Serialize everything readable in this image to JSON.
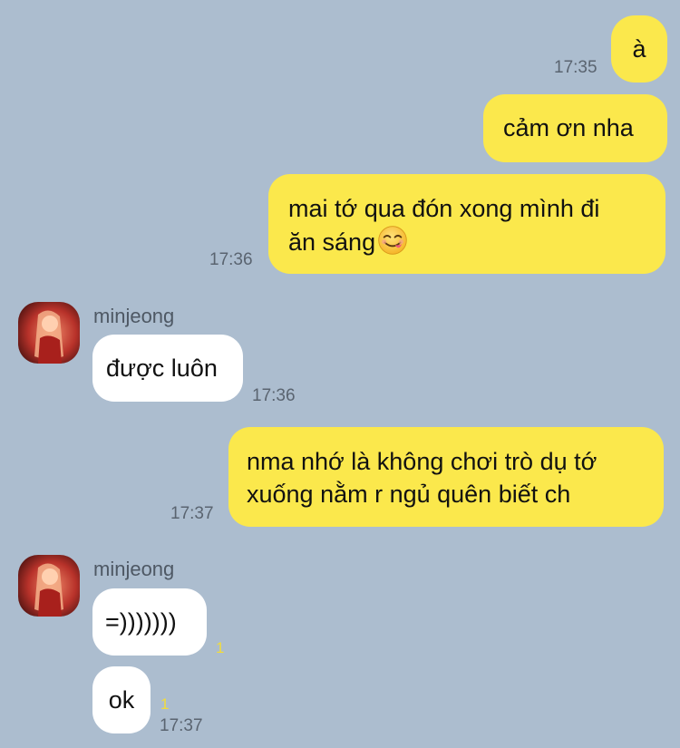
{
  "messages": [
    {
      "side": "me",
      "text": "à",
      "time": "17:35"
    },
    {
      "side": "me",
      "text": "cảm ơn nha",
      "time": ""
    },
    {
      "side": "me",
      "line1": "mai tớ qua đón xong mình đi",
      "line2": "ăn sáng",
      "emoji": "yum-face-emoji",
      "time": "17:36"
    },
    {
      "side": "them",
      "sender": "minjeong",
      "text": "được luôn",
      "time": "17:36"
    },
    {
      "side": "me",
      "line1": "nma nhớ là không chơi trò dụ tớ",
      "line2": "xuống nằm r ngủ quên biết ch",
      "time": "17:37"
    },
    {
      "side": "them",
      "sender": "minjeong",
      "text": "=)))))))",
      "unread": "1",
      "time": ""
    },
    {
      "side": "them",
      "text": "ok",
      "unread": "1",
      "time": "17:37"
    }
  ],
  "colors": {
    "background": "#acbdcf",
    "my_bubble": "#fbe84c",
    "their_bubble": "#ffffff",
    "unread_count": "#f2dc3a"
  },
  "icons": {
    "avatar": "contact-avatar-photo"
  }
}
